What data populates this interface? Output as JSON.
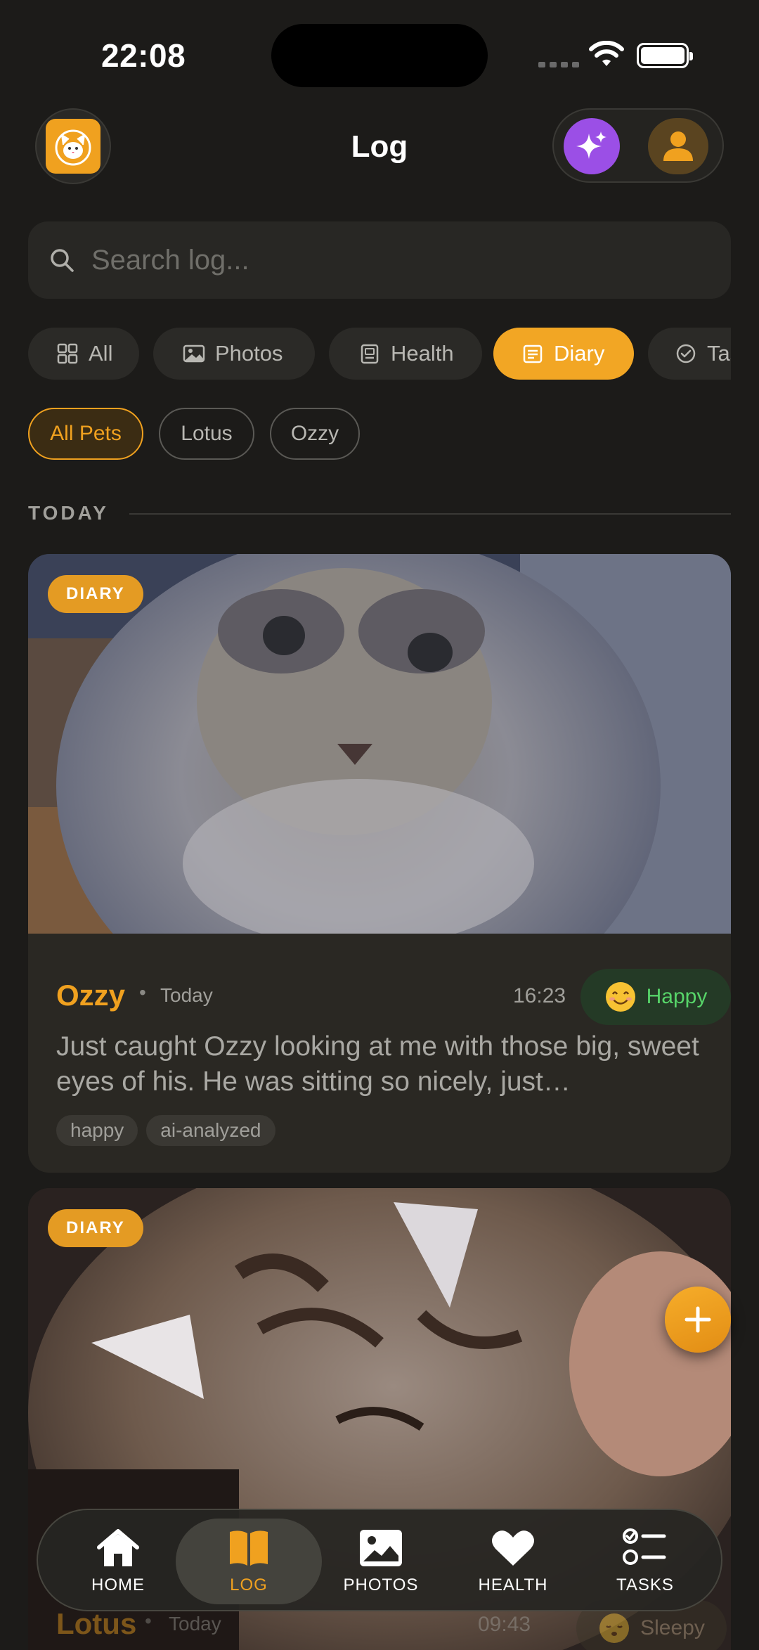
{
  "status_bar": {
    "time": "22:08"
  },
  "header": {
    "title": "Log"
  },
  "search": {
    "placeholder": "Search log..."
  },
  "filter_tabs": [
    {
      "label": "All",
      "icon": "grid-icon",
      "active": false
    },
    {
      "label": "Photos",
      "icon": "image-icon",
      "active": false
    },
    {
      "label": "Health",
      "icon": "clipboard-icon",
      "active": false
    },
    {
      "label": "Diary",
      "icon": "notebook-icon",
      "active": true
    },
    {
      "label": "Tasks",
      "icon": "check-circle-icon",
      "active": false
    }
  ],
  "pet_filters": [
    {
      "label": "All Pets",
      "active": true
    },
    {
      "label": "Lotus",
      "active": false
    },
    {
      "label": "Ozzy",
      "active": false
    }
  ],
  "section": {
    "label": "TODAY"
  },
  "entries": [
    {
      "badge": "DIARY",
      "pet": "Ozzy",
      "day": "Today",
      "time": "16:23",
      "mood": "Happy",
      "mood_icon": "smiling-face-icon",
      "text": "Just caught Ozzy looking at me with those big, sweet eyes of his. He was sitting so nicely, just…",
      "tags": [
        "happy",
        "ai-analyzed"
      ]
    },
    {
      "badge": "DIARY",
      "pet": "Lotus",
      "day": "Today",
      "time": "09:43",
      "mood": "Sleepy",
      "mood_icon": "sleepy-face-icon"
    }
  ],
  "bottom_nav": [
    {
      "label": "HOME",
      "icon": "home-icon",
      "active": false
    },
    {
      "label": "LOG",
      "icon": "book-icon",
      "active": true
    },
    {
      "label": "PHOTOS",
      "icon": "photo-icon",
      "active": false
    },
    {
      "label": "HEALTH",
      "icon": "heart-icon",
      "active": false
    },
    {
      "label": "TASKS",
      "icon": "tasks-icon",
      "active": false
    }
  ],
  "colors": {
    "background": "#1c1b19",
    "accent": "#f0a11f",
    "ai_purple": "#9b4fe6",
    "mood_happy_text": "#57d469",
    "mood_happy_bg": "#243a26"
  }
}
